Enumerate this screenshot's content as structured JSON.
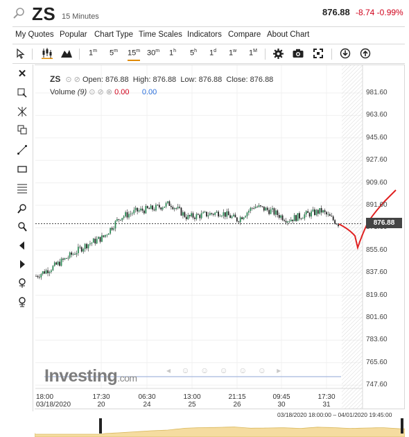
{
  "header": {
    "symbol": "ZS",
    "interval": "15 Minutes",
    "last_price": "876.88",
    "change": "-8.74 -0.99%",
    "change_color": "#d0021b"
  },
  "menu": [
    "My Quotes",
    "Popular",
    "Chart Type",
    "Time Scales",
    "Indicators",
    "Compare",
    "About Chart"
  ],
  "toolbar": {
    "timescales": [
      {
        "label": "1",
        "unit": "m"
      },
      {
        "label": "5",
        "unit": "m"
      },
      {
        "label": "15",
        "unit": "m",
        "selected": true
      },
      {
        "label": "30",
        "unit": "m"
      },
      {
        "label": "1",
        "unit": "h"
      },
      {
        "label": "5",
        "unit": "h"
      },
      {
        "label": "1",
        "unit": "d"
      },
      {
        "label": "1",
        "unit": "w"
      },
      {
        "label": "1",
        "unit": "M"
      }
    ],
    "selected_color": "#e08a00"
  },
  "legend": {
    "symbol": "ZS",
    "open_label": "Open:",
    "open": "876.88",
    "high_label": "High:",
    "high": "876.88",
    "low_label": "Low:",
    "low": "876.88",
    "close_label": "Close:",
    "close": "876.88",
    "volume_label": "Volume",
    "volume_period": "(9)",
    "volume_value": "0.00",
    "volume_ma": "0.00"
  },
  "chart_data": {
    "type": "candlestick",
    "symbol": "ZS",
    "interval": "15 Minutes",
    "y_ticks": [
      "981.60",
      "963.60",
      "945.60",
      "927.60",
      "909.60",
      "891.60",
      "873.60",
      "855.60",
      "837.60",
      "819.60",
      "801.60",
      "783.60",
      "765.60",
      "747.60"
    ],
    "ylim": [
      747.6,
      981.6
    ],
    "last_price": 876.88,
    "x_ticks": [
      {
        "time": "18:00",
        "date": "03/18/2020"
      },
      {
        "time": "17:30",
        "date": "20"
      },
      {
        "time": "06:30",
        "date": "24"
      },
      {
        "time": "13:00",
        "date": "25"
      },
      {
        "time": "21:15",
        "date": "26"
      },
      {
        "time": "09:45",
        "date": "30"
      },
      {
        "time": "17:30",
        "date": "31"
      }
    ],
    "series_trend": [
      [
        "03/18 18:00",
        835
      ],
      [
        "03/19 12:00",
        842
      ],
      [
        "03/20 06:00",
        851
      ],
      [
        "03/20 17:30",
        860
      ],
      [
        "03/23 12:00",
        866
      ],
      [
        "03/24 06:30",
        882
      ],
      [
        "03/24 18:00",
        887
      ],
      [
        "03/25 06:00",
        889
      ],
      [
        "03/25 13:00",
        893
      ],
      [
        "03/26 06:00",
        882
      ],
      [
        "03/26 21:15",
        884
      ],
      [
        "03/27 12:00",
        886
      ],
      [
        "03/30 06:00",
        880
      ],
      [
        "03/30 09:45",
        891
      ],
      [
        "03/30 18:00",
        887
      ],
      [
        "03/31 06:00",
        880
      ],
      [
        "03/31 12:00",
        884
      ],
      [
        "03/31 17:30",
        887
      ],
      [
        "04/01 06:00",
        876.88
      ]
    ],
    "range_text": "03/18/2020 18:00:00 – 04/01/2020 19:45:00",
    "grid": true,
    "candle_up_color": "#2e8b57",
    "candle_down_color": "#222222",
    "annotation_color": "#e02020"
  },
  "branding": {
    "logo_text": "Investing",
    "logo_suffix": ".com"
  }
}
